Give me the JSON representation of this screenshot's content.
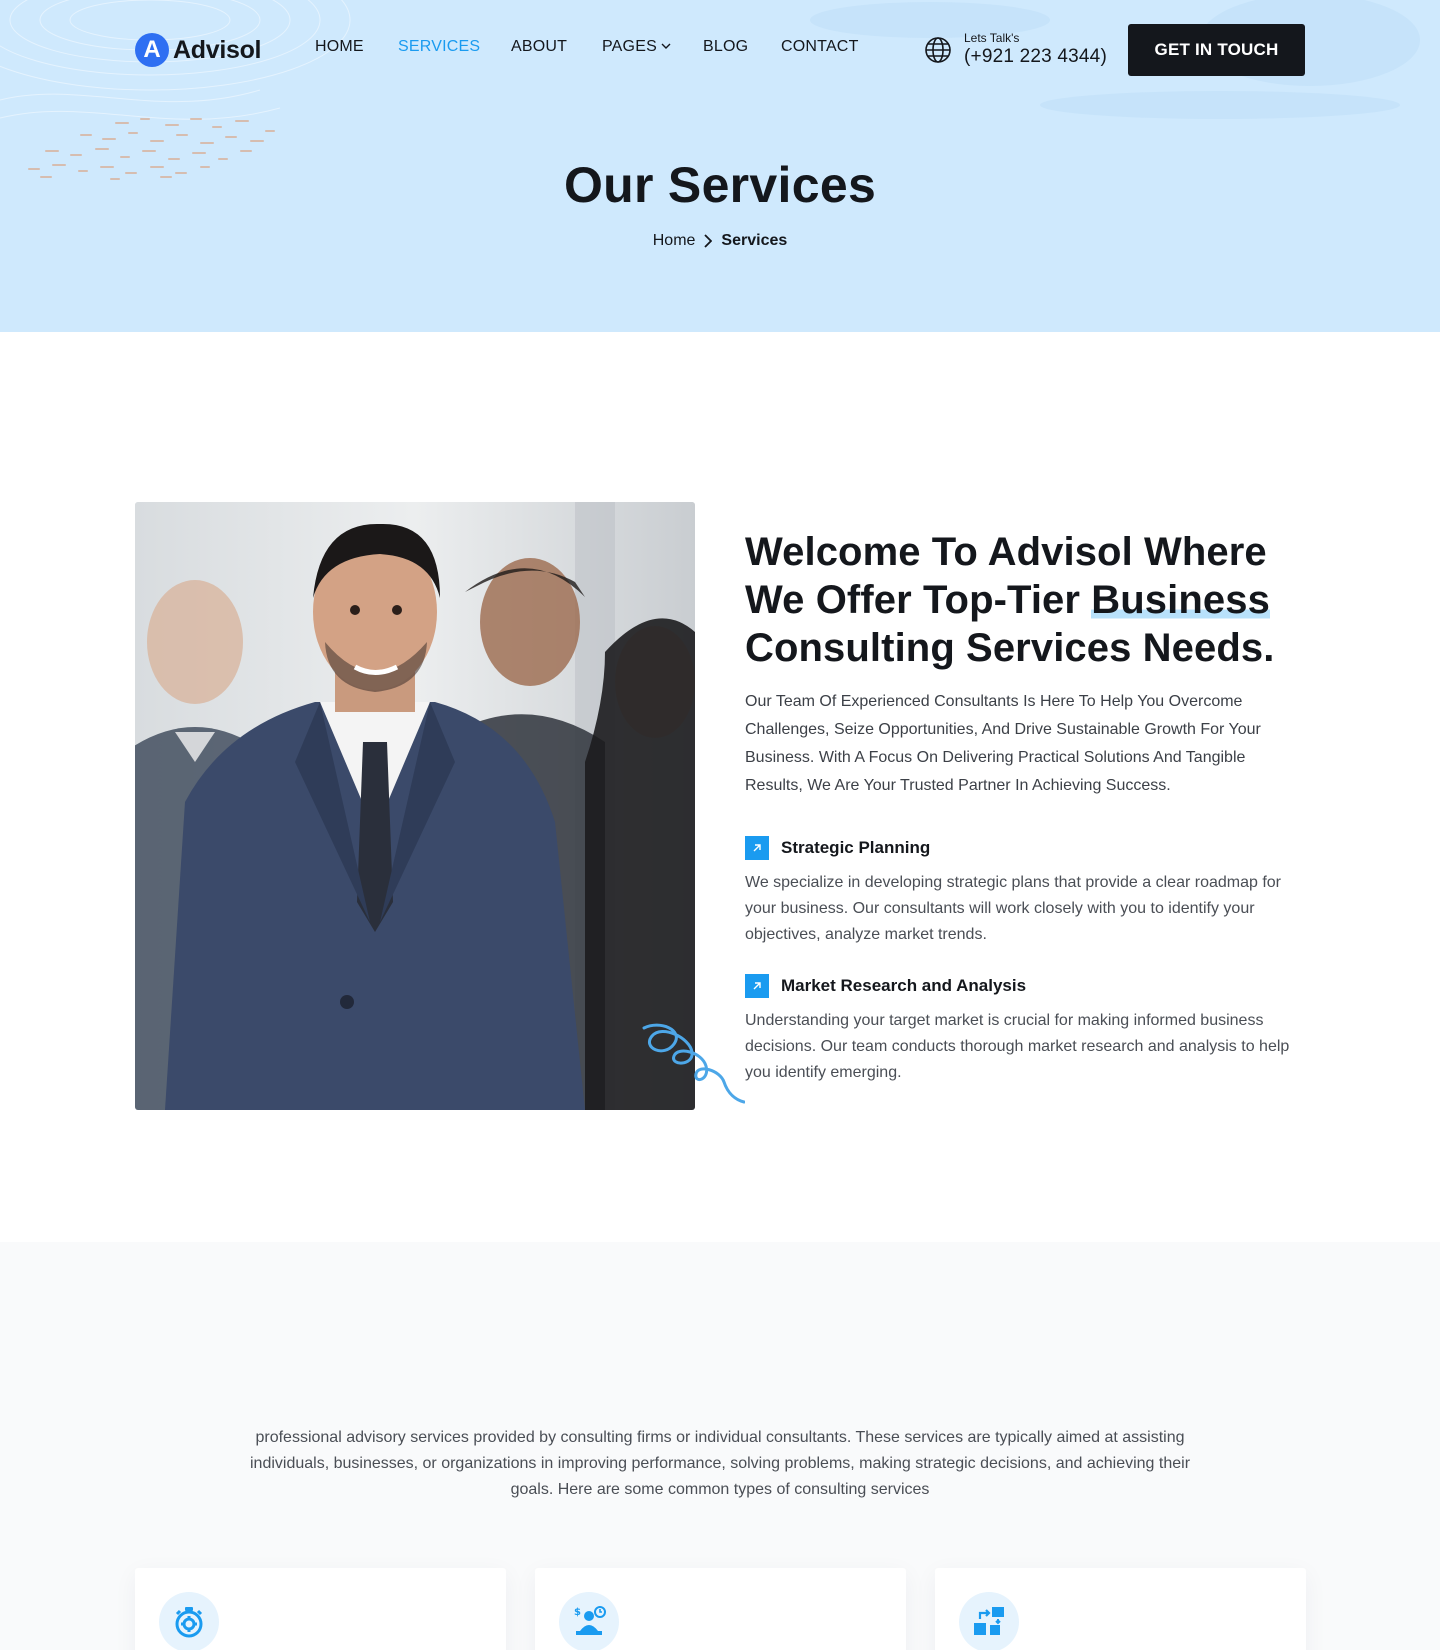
{
  "brand": {
    "logo_letter": "A",
    "name": "Advisol"
  },
  "nav": {
    "items": [
      {
        "label": "HOME",
        "active": false
      },
      {
        "label": "SERVICES",
        "active": true
      },
      {
        "label": "ABOUT",
        "active": false
      },
      {
        "label": "PAGES",
        "active": false,
        "has_dropdown": true
      },
      {
        "label": "BLOG",
        "active": false
      },
      {
        "label": "CONTACT",
        "active": false
      }
    ]
  },
  "contact": {
    "icon": "globe-icon",
    "label": "Lets Talk's",
    "phone": "(+921 223 4344)"
  },
  "cta": {
    "label": "GET IN TOUCH"
  },
  "hero": {
    "title": "Our Services",
    "breadcrumb": {
      "home": "Home",
      "separator_icon": "chevron-right-icon",
      "current": "Services"
    }
  },
  "about": {
    "title_before": "Welcome To Advisol Where We Offer Top-Tier ",
    "title_highlight": "Business",
    "title_after": " Consulting Services Needs.",
    "description": "Our Team Of Experienced Consultants Is Here To Help You Overcome Challenges, Seize Opportunities, And Drive Sustainable Growth For Your Business. With A Focus On Delivering Practical Solutions And Tangible Results, We Are Your Trusted Partner In Achieving Success.",
    "features": [
      {
        "icon": "arrow-up-right-icon",
        "title": "Strategic Planning",
        "description": "We specialize in developing strategic plans that provide a clear roadmap for your business. Our consultants will work closely with you to identify your objectives, analyze market trends."
      },
      {
        "icon": "arrow-up-right-icon",
        "title": "Market Research and Analysis",
        "description": "Understanding your target market is crucial for making informed business decisions. Our team conducts thorough market research and analysis to help you identify emerging."
      }
    ]
  },
  "services": {
    "intro": "professional advisory services provided by consulting firms or individual consultants. These services are typically aimed at assisting individuals, businesses, or organizations in improving performance, solving problems, making strategic decisions, and achieving their goals. Here are some common types of consulting services",
    "cards": [
      {
        "icon": "stopwatch-gear-icon"
      },
      {
        "icon": "consultant-desk-icon"
      },
      {
        "icon": "workflow-icon"
      }
    ]
  },
  "colors": {
    "accent": "#1a9bf0",
    "hero_bg": "#cfe9fd",
    "dark": "#14171c",
    "logo": "#2e6ff2"
  }
}
